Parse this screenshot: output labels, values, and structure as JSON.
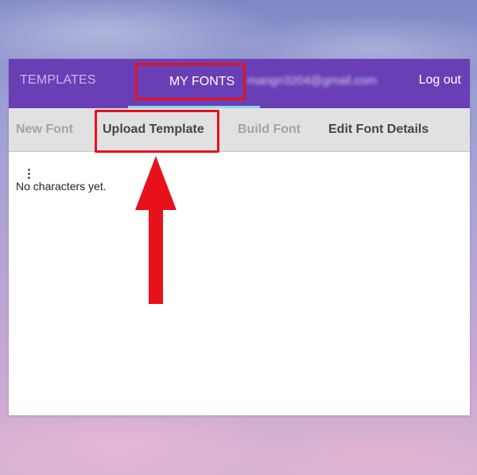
{
  "topbar": {
    "templates_label": "TEMPLATES",
    "my_fonts_label": "MY FONTS",
    "user_email": "mangn3204@gmail.com",
    "logout_label": "Log out"
  },
  "toolbar": {
    "new_font_label": "New Font",
    "upload_template_label": "Upload Template",
    "build_font_label": "Build Font",
    "edit_font_details_label": "Edit Font Details"
  },
  "content": {
    "empty_message": "No characters yet."
  },
  "icons": {
    "menu": "more-vertical-icon",
    "annotation": "arrow-up-icon"
  },
  "colors": {
    "brand_purple": "#6a3fb6",
    "active_tab_indicator": "#8ad8f0",
    "toolbar_gray": "#e1e1e1",
    "annotation_red": "#e8101a"
  }
}
